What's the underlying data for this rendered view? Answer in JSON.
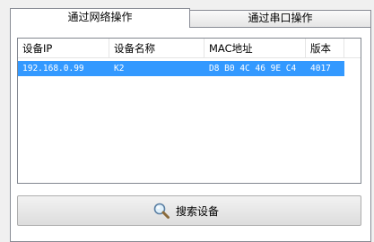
{
  "tabs": [
    {
      "label": "通过网络操作",
      "selected": true
    },
    {
      "label": "通过串口操作",
      "selected": false
    }
  ],
  "table": {
    "columns": [
      "设备IP",
      "设备名称",
      "MAC地址",
      "版本"
    ],
    "rows": [
      {
        "ip": "192.168.0.99",
        "name": "K2",
        "mac": "D8 B0 4C 46 9E C4",
        "version": "4017",
        "selected": true
      }
    ]
  },
  "search_button": {
    "label": "搜索设备",
    "icon": "magnifier-icon"
  },
  "colors": {
    "selection": "#3399ff",
    "border": "#898c95",
    "background": "#f0f0f0"
  }
}
